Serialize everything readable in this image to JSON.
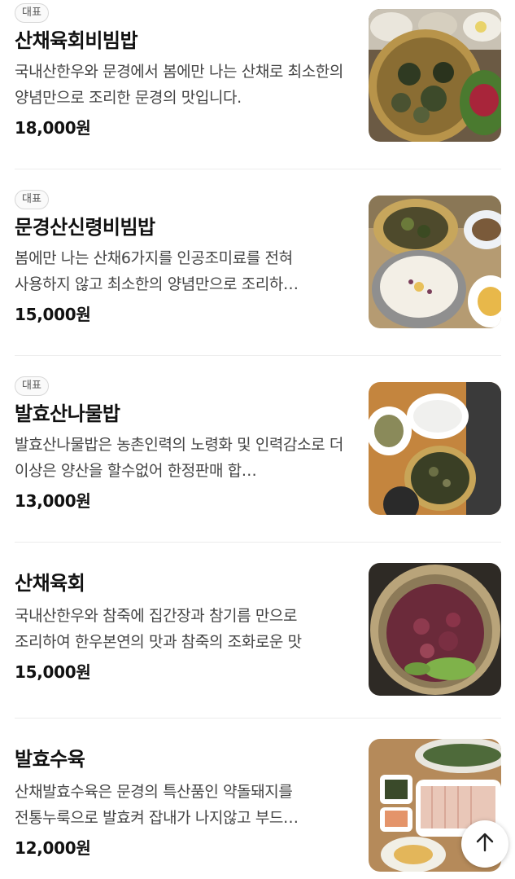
{
  "menu": {
    "items": [
      {
        "badge": "대표",
        "name": "산채육회비빔밥",
        "description": "국내산한우와 문경에서 봄에만 나는 산채로 최소한의 양념만으로 조리한 문경의 맛입니다.",
        "price": "18,000원",
        "image_icon": "bibimbap-photo"
      },
      {
        "badge": "대표",
        "name": "문경산신령비빔밥",
        "description": "봄에만 나는 산채6가지를 인공조미료를 전혀 사용하지 않고 최소한의 양념만으로 조리하…",
        "price": "15,000원",
        "image_icon": "rice-pot-photo"
      },
      {
        "badge": "대표",
        "name": "발효산나물밥",
        "description": "발효산나물밥은 농촌인력의 노령화 및 인력감소로 더 이상은 양산을 할수없어 한정판매 합…",
        "price": "13,000원",
        "image_icon": "namul-bowl-photo"
      },
      {
        "badge": "",
        "name": "산채육회",
        "description": "국내산한우와 참죽에 집간장과 참기름 만으로 조리하여 한우본연의 맛과 참죽의 조화로운 맛",
        "price": "15,000원",
        "image_icon": "yukhoe-photo"
      },
      {
        "badge": "",
        "name": "발효수육",
        "description": "산채발효수육은 문경의 특산품인 약돌돼지를 전통누룩으로 발효켜 잡내가 나지않고 부드…",
        "price": "12,000원",
        "image_icon": "suyuk-photo"
      }
    ]
  },
  "scroll_top_button": {
    "icon": "arrow-up-icon"
  }
}
